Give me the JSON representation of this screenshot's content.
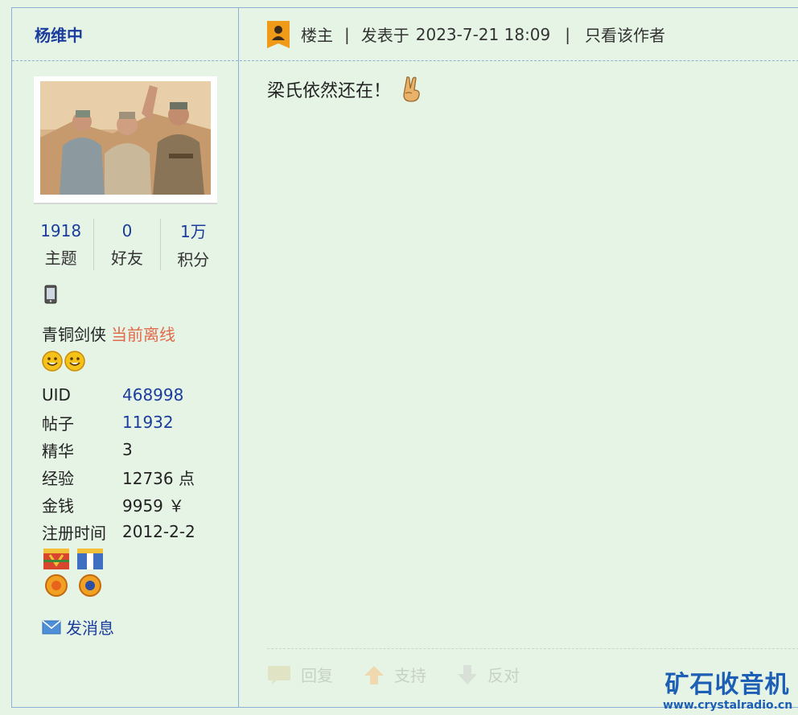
{
  "user": {
    "name": "杨维中",
    "stats": [
      {
        "value": "1918",
        "label": "主题"
      },
      {
        "value": "0",
        "label": "好友"
      },
      {
        "value": "1万",
        "label": "积分"
      }
    ],
    "rank": "青铜剑侠",
    "status": "当前离线",
    "info": [
      {
        "key": "UID",
        "value": "468998"
      },
      {
        "key": "帖子",
        "value": "11932"
      },
      {
        "key": "精华",
        "value": "3"
      },
      {
        "key": "经验",
        "value": "12736 点"
      },
      {
        "key": "金钱",
        "value": "9959 ￥"
      },
      {
        "key": "注册时间",
        "value": "2012-2-2"
      }
    ],
    "send_message": "发消息"
  },
  "post": {
    "role": "楼主",
    "posted_label": "发表于",
    "posted_time": "2023-7-21 18:09",
    "only_author": "只看该作者",
    "content": "梁氏依然还在！",
    "actions": {
      "reply": "回复",
      "support": "支持",
      "oppose": "反对"
    }
  },
  "watermark": {
    "title": "矿石收音机",
    "url": "www.crystalradio.cn"
  },
  "colors": {
    "background": "#e6f4e5",
    "link": "#1b3c9d",
    "offline": "#e06a4b",
    "border": "#8fb0d6"
  }
}
